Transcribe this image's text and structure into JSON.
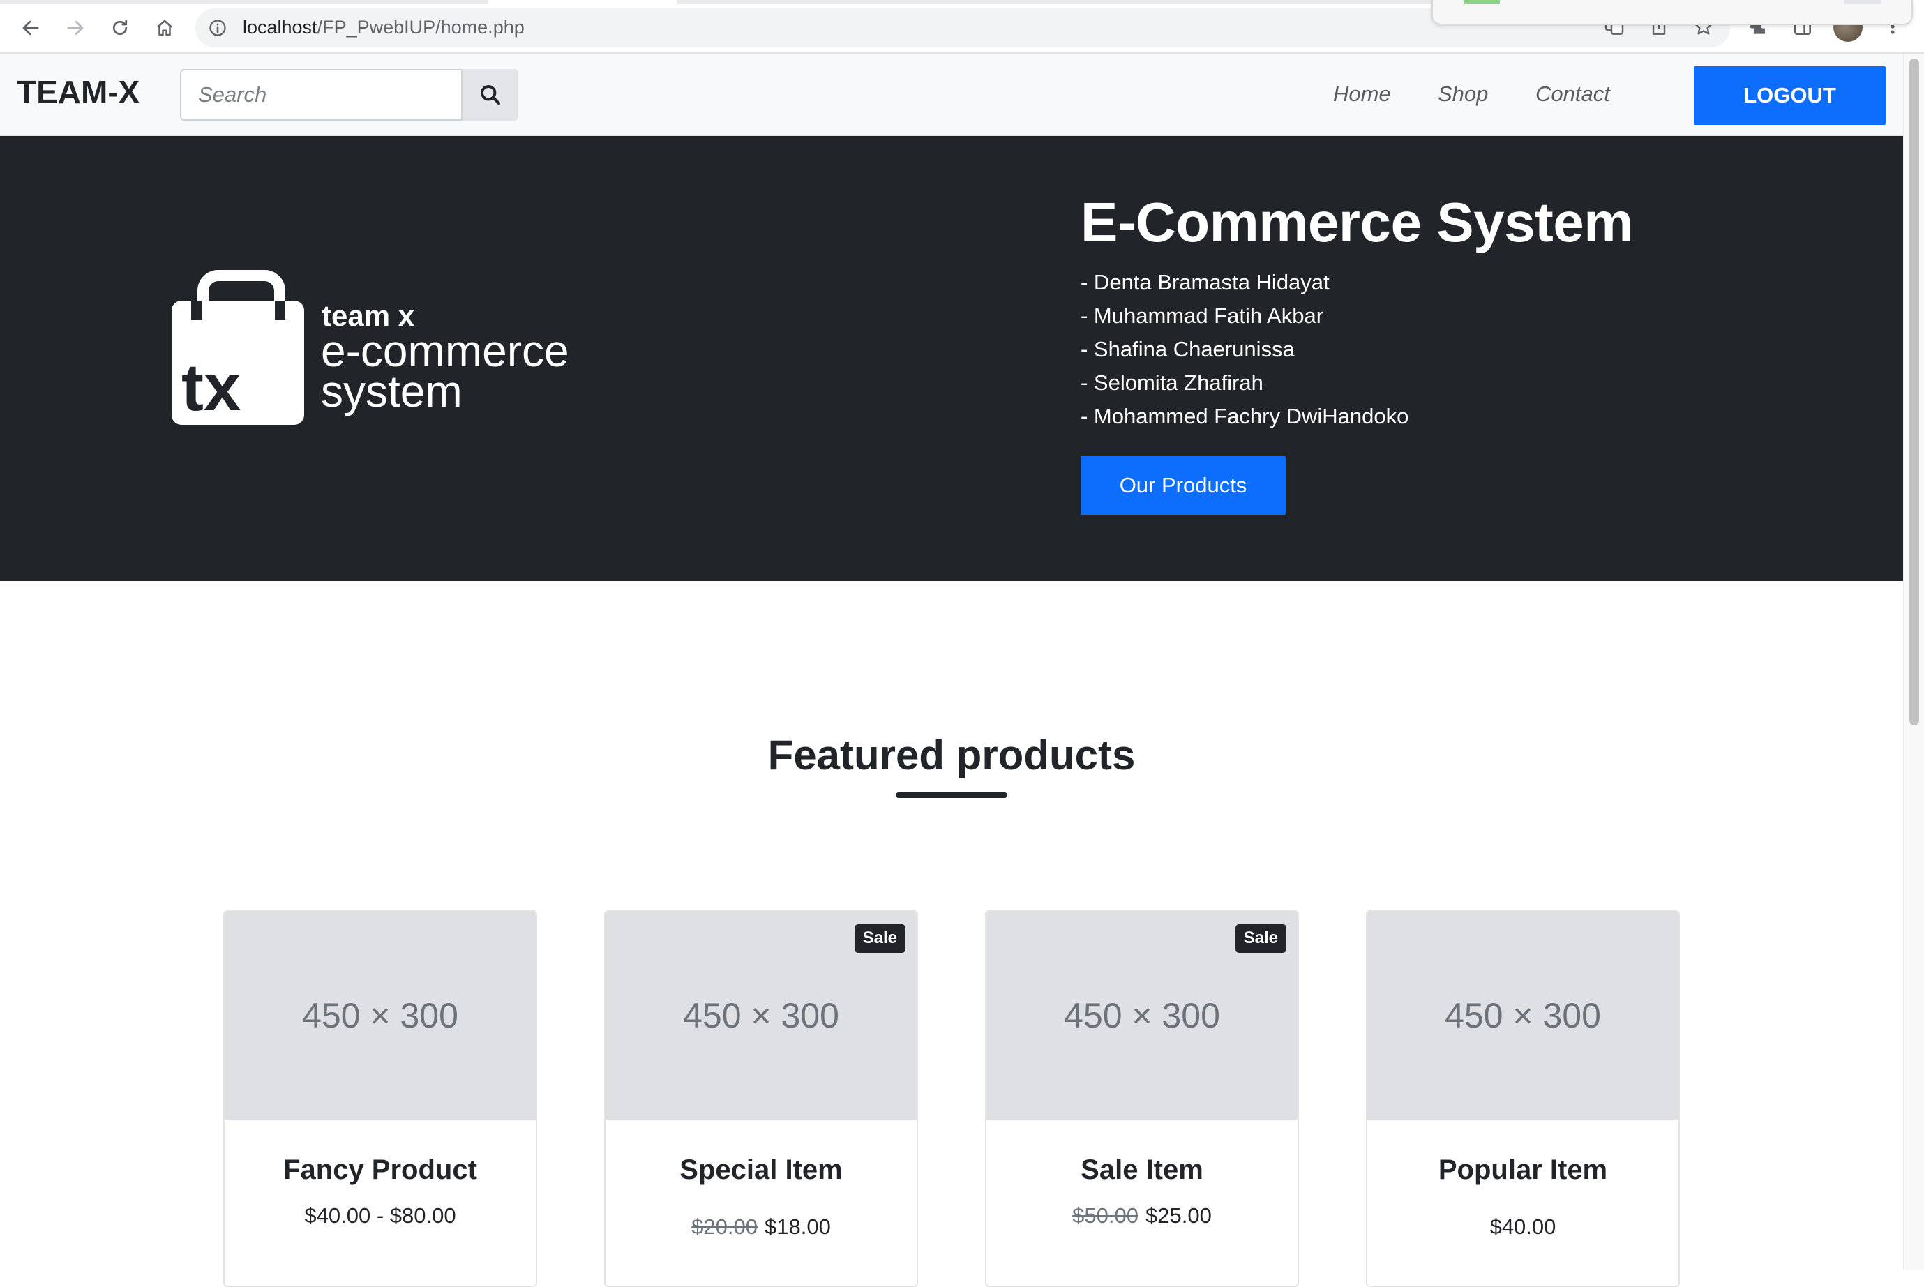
{
  "browser": {
    "url_host": "localhost",
    "url_path": "/FP_PwebIUP/home.php"
  },
  "navbar": {
    "brand": "TEAM-X",
    "search_placeholder": "Search",
    "links": [
      "Home",
      "Shop",
      "Contact"
    ],
    "logout_label": "LOGOUT"
  },
  "hero": {
    "logo": {
      "badge_text": "tx",
      "line1": "team x",
      "line2": "e-commerce",
      "line3": "system"
    },
    "title": "E-Commerce System",
    "members": [
      "- Denta Bramasta Hidayat",
      "- Muhammad Fatih Akbar",
      "- Shafina Chaerunissa",
      "- Selomita Zhafirah",
      "- Mohammed Fachry DwiHandoko"
    ],
    "button_label": "Our Products"
  },
  "featured": {
    "title": "Featured products",
    "products": [
      {
        "image_text": "450 × 300",
        "badge": "",
        "name": "Fancy Product",
        "old_price": "",
        "price": "$40.00 - $80.00"
      },
      {
        "image_text": "450 × 300",
        "badge": "Sale",
        "name": "Special Item",
        "old_price": "$20.00",
        "price": "$18.00"
      },
      {
        "image_text": "450 × 300",
        "badge": "Sale",
        "name": "Sale Item",
        "old_price": "$50.00",
        "price": "$25.00"
      },
      {
        "image_text": "450 × 300",
        "badge": "",
        "name": "Popular Item",
        "old_price": "",
        "price": "$40.00"
      }
    ]
  },
  "colors": {
    "primary": "#0d6efd",
    "dark": "#212529",
    "navbar_bg": "#f8f9fa",
    "placeholder_bg": "#dee0e4"
  }
}
